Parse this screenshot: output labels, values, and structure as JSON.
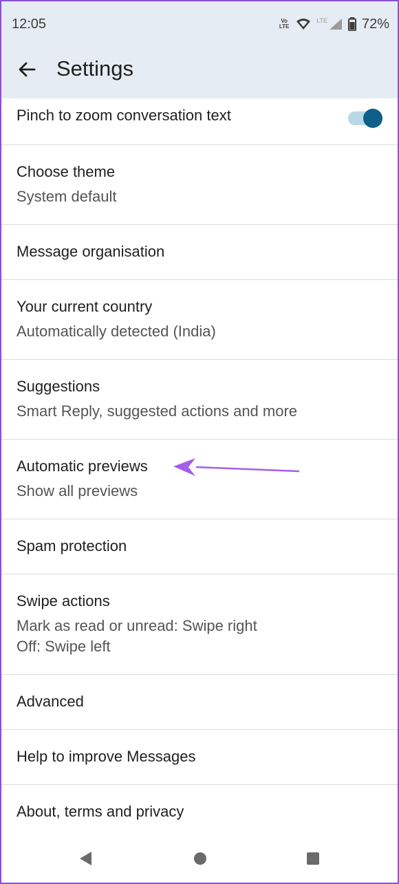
{
  "status_bar": {
    "time": "12:05",
    "volte_label": "Vo\nLTE",
    "lte_label": "LTE",
    "battery": "72%"
  },
  "app_bar": {
    "title": "Settings",
    "back_icon": "arrow-back-icon"
  },
  "settings": [
    {
      "primary": "Pinch to zoom conversation text",
      "toggle": true
    },
    {
      "primary": "Choose theme",
      "secondary": "System default"
    },
    {
      "primary": "Message organisation"
    },
    {
      "primary": "Your current country",
      "secondary": "Automatically detected (India)"
    },
    {
      "primary": "Suggestions",
      "secondary": "Smart Reply, suggested actions and more"
    },
    {
      "primary": "Automatic previews",
      "secondary": "Show all previews"
    },
    {
      "primary": "Spam protection"
    },
    {
      "primary": "Swipe actions",
      "secondary": "Mark as read or unread: Swipe right",
      "secondary2": "Off: Swipe left"
    },
    {
      "primary": "Advanced"
    },
    {
      "primary": "Help to improve Messages"
    },
    {
      "primary": "About, terms and privacy"
    }
  ],
  "annotation": {
    "icon": "purple-arrow-icon",
    "color": "#a45ee8"
  },
  "colors": {
    "header_bg": "#e6ecf3",
    "toggle_thumb": "#0e5f8a",
    "toggle_track": "#b9d8e6",
    "frame": "#8a4fd6"
  },
  "nav_bar": {
    "icons": [
      "nav-back-icon",
      "nav-home-icon",
      "nav-recents-icon"
    ]
  }
}
